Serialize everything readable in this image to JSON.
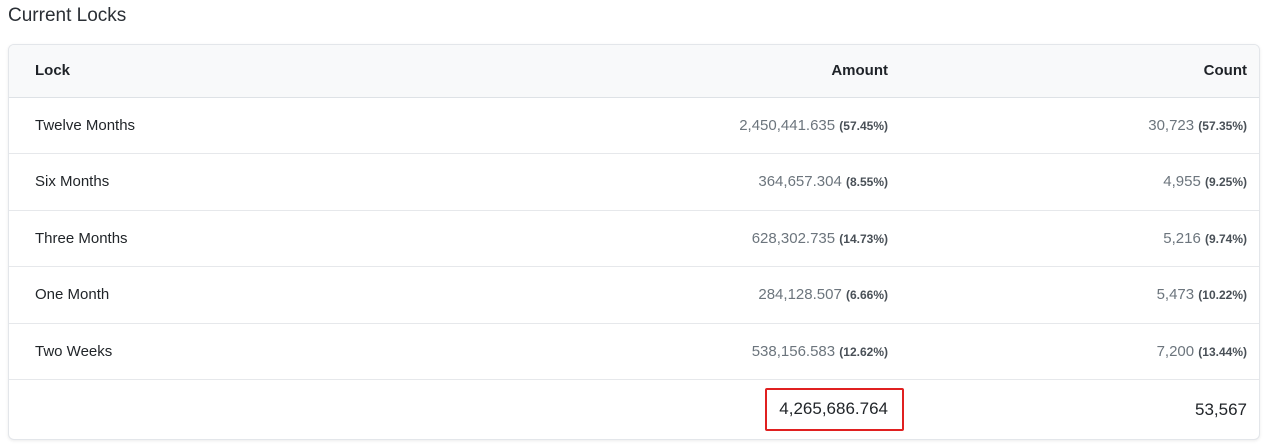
{
  "section_title": "Current Locks",
  "table": {
    "headers": {
      "lock": "Lock",
      "amount": "Amount",
      "count": "Count"
    },
    "rows": [
      {
        "lock": "Twelve Months",
        "amount": "2,450,441.635",
        "amount_pct": "(57.45%)",
        "count": "30,723",
        "count_pct": "(57.35%)"
      },
      {
        "lock": "Six Months",
        "amount": "364,657.304",
        "amount_pct": "(8.55%)",
        "count": "4,955",
        "count_pct": "(9.25%)"
      },
      {
        "lock": "Three Months",
        "amount": "628,302.735",
        "amount_pct": "(14.73%)",
        "count": "5,216",
        "count_pct": "(9.74%)"
      },
      {
        "lock": "One Month",
        "amount": "284,128.507",
        "amount_pct": "(6.66%)",
        "count": "5,473",
        "count_pct": "(10.22%)"
      },
      {
        "lock": "Two Weeks",
        "amount": "538,156.583",
        "amount_pct": "(12.62%)",
        "count": "7,200",
        "count_pct": "(13.44%)"
      }
    ],
    "totals": {
      "amount": "4,265,686.764",
      "count": "53,567"
    }
  },
  "colors": {
    "highlight_border": "#e02020",
    "header_bg": "#f8f9fa",
    "muted_text": "#6c757d"
  }
}
